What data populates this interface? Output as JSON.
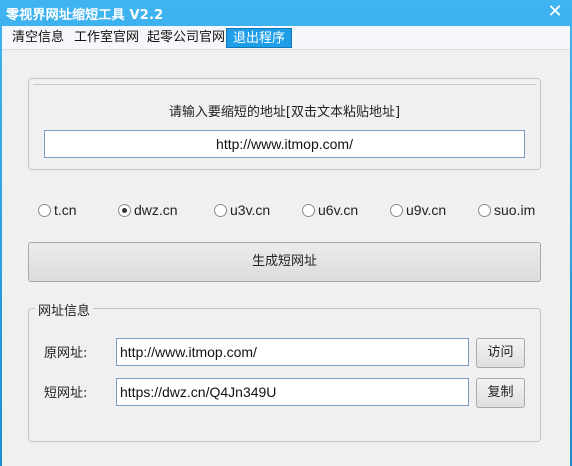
{
  "window": {
    "title": "零视界网址缩短工具 V2.2",
    "close_glyph": "✕"
  },
  "menu": {
    "items": [
      {
        "label": "清空信息"
      },
      {
        "label": "工作室官网"
      },
      {
        "label": "起零公司官网"
      },
      {
        "label": "退出程序",
        "active": true
      }
    ]
  },
  "input_section": {
    "prompt": "请输入要缩短的地址[双击文本粘贴地址]",
    "url_value": "http://www.itmop.com/"
  },
  "services": {
    "options": [
      "t.cn",
      "dwz.cn",
      "u3v.cn",
      "u6v.cn",
      "u9v.cn",
      "suo.im"
    ],
    "selected": "dwz.cn"
  },
  "generate_button": {
    "label": "生成短网址"
  },
  "info_group": {
    "title": "网址信息",
    "original_label": "原网址:",
    "original_value": "http://www.itmop.com/",
    "visit_label": "访问",
    "short_label": "短网址:",
    "short_value": "https://dwz.cn/Q4Jn349U",
    "copy_label": "复制"
  },
  "colors": {
    "titlebar": "#2aa3e4",
    "accent": "#1e9ee8",
    "client_bg": "#f0f0f0"
  }
}
